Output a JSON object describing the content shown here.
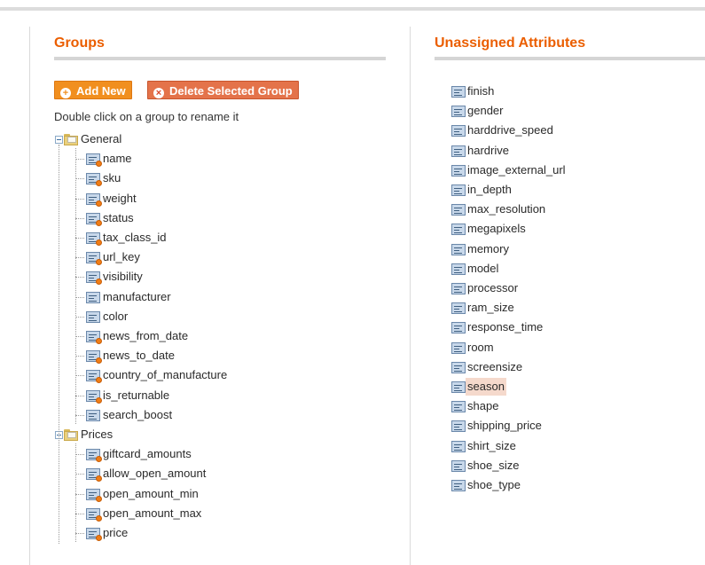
{
  "groups_heading": "Groups",
  "unassigned_heading": "Unassigned Attributes",
  "buttons": {
    "add_new": "Add New",
    "delete_group": "Delete Selected Group"
  },
  "hint": "Double click on a group to rename it",
  "tree": {
    "groups": [
      {
        "name": "General",
        "items": [
          "name",
          "sku",
          "weight",
          "status",
          "tax_class_id",
          "url_key",
          "visibility",
          "manufacturer",
          "color",
          "news_from_date",
          "news_to_date",
          "country_of_manufacture",
          "is_returnable",
          "search_boost"
        ]
      },
      {
        "name": "Prices",
        "items": [
          "giftcard_amounts",
          "allow_open_amount",
          "open_amount_min",
          "open_amount_max",
          "price"
        ]
      }
    ]
  },
  "unassigned": [
    "finish",
    "gender",
    "harddrive_speed",
    "hardrive",
    "image_external_url",
    "in_depth",
    "max_resolution",
    "megapixels",
    "memory",
    "model",
    "processor",
    "ram_size",
    "response_time",
    "room",
    "screensize",
    "season",
    "shape",
    "shipping_price",
    "shirt_size",
    "shoe_size",
    "shoe_type"
  ],
  "selected_unassigned": "season"
}
